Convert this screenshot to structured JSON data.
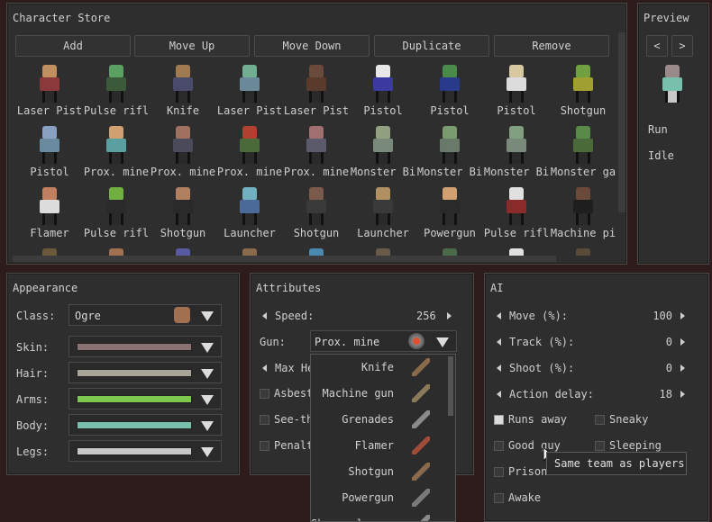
{
  "store": {
    "title": "Character Store",
    "buttons": [
      "Add",
      "Move Up",
      "Move Down",
      "Duplicate",
      "Remove"
    ],
    "characters": [
      {
        "label": "Laser Pist",
        "head": "#c09060",
        "body": "#8a3a3a"
      },
      {
        "label": "Pulse rifl",
        "head": "#5aa060",
        "body": "#3a5a3a"
      },
      {
        "label": "Knife",
        "head": "#a07a50",
        "body": "#4a4a6a"
      },
      {
        "label": "Laser Pist",
        "head": "#70b090",
        "body": "#6a8a9a"
      },
      {
        "label": "Laser Pist",
        "head": "#6a4a3a",
        "body": "#5a3a2a"
      },
      {
        "label": "Pistol",
        "head": "#e8e8e8",
        "body": "#3a3aa0"
      },
      {
        "label": "Pistol",
        "head": "#4a8a4a",
        "body": "#2a3a8a"
      },
      {
        "label": "Pistol",
        "head": "#d8c8a0",
        "body": "#dcdcdc"
      },
      {
        "label": "Shotgun",
        "head": "#70a040",
        "body": "#a0a030"
      },
      {
        "label": "Pistol",
        "head": "#8aa0c0",
        "body": "#6a8aa0"
      },
      {
        "label": "Prox. mine",
        "head": "#d0a070",
        "body": "#5aa0a0"
      },
      {
        "label": "Prox. mine",
        "head": "#a07060",
        "body": "#4a4a5a"
      },
      {
        "label": "Prox. mine",
        "head": "#b04030",
        "body": "#4a6a3a"
      },
      {
        "label": "Prox. mine",
        "head": "#a07070",
        "body": "#5a5a6a"
      },
      {
        "label": "Monster Bi",
        "head": "#90a080",
        "body": "#7a8a7a"
      },
      {
        "label": "Monster Bi",
        "head": "#7a9a70",
        "body": "#6a7a6a"
      },
      {
        "label": "Monster Bi",
        "head": "#80a080",
        "body": "#7a8a7a"
      },
      {
        "label": "Monster ga",
        "head": "#5a8a4a",
        "body": "#4a6a3a"
      },
      {
        "label": "Flamer",
        "head": "#c08060",
        "body": "#dcdcdc"
      },
      {
        "label": "Pulse rifl",
        "head": "#70b040",
        "body": "#2a2a2a"
      },
      {
        "label": "Shotgun",
        "head": "#b08060",
        "body": "#2a2a2a"
      },
      {
        "label": "Launcher",
        "head": "#70b0c0",
        "body": "#4a6a9a"
      },
      {
        "label": "Shotgun",
        "head": "#7a5a4a",
        "body": "#3a3a3a"
      },
      {
        "label": "Launcher",
        "head": "#b09060",
        "body": "#3a3a3a"
      },
      {
        "label": "Powergun",
        "head": "#d0a070",
        "body": "#2a2a2a"
      },
      {
        "label": "Pulse rifl",
        "head": "#e0e0e0",
        "body": "#8a2a2a"
      },
      {
        "label": "Machine pi",
        "head": "#6a4a3a",
        "body": "#1e1e1e"
      }
    ]
  },
  "preview": {
    "title": "Preview",
    "prev": "<",
    "next": ">",
    "animations": [
      "Run",
      "Idle"
    ]
  },
  "appearance": {
    "title": "Appearance",
    "class_label": "Class:",
    "class_value": "Ogre",
    "rows": [
      {
        "label": "Skin:",
        "color": "#8a7272"
      },
      {
        "label": "Hair:",
        "color": "#a8a49a"
      },
      {
        "label": "Arms:",
        "color": "#7ec850"
      },
      {
        "label": "Body:",
        "color": "#78c0ac"
      },
      {
        "label": "Legs:",
        "color": "#c8c8c8"
      }
    ]
  },
  "attributes": {
    "title": "Attributes",
    "speed_label": "Speed:",
    "speed_value": "256",
    "gun_label": "Gun:",
    "gun_value": "Prox. mine",
    "max_health": "Max He",
    "checkboxes": [
      "Asbest",
      "See-th",
      "Penalt"
    ]
  },
  "gun_menu": {
    "items": [
      "Knife",
      "Machine gun",
      "Grenades",
      "Flamer",
      "Shotgun",
      "Powergun",
      "Shrapnel bomb"
    ],
    "icon_colors": [
      "#8a6a4a",
      "#8a7a5a",
      "#8a8a8a",
      "#a04a3a",
      "#8a6a4a",
      "#7a7a7a",
      "#8a8a8a"
    ]
  },
  "ai": {
    "title": "AI",
    "sliders": [
      {
        "label": "Move (%):",
        "value": "100"
      },
      {
        "label": "Track (%):",
        "value": "0"
      },
      {
        "label": "Shoot (%):",
        "value": "0"
      },
      {
        "label": "Action delay:",
        "value": "18"
      }
    ],
    "checkboxes": [
      "Runs away",
      "Sneaky",
      "Good guy",
      "Sleeping",
      "Prison",
      "Awake"
    ],
    "tooltip": "Same team as players"
  }
}
